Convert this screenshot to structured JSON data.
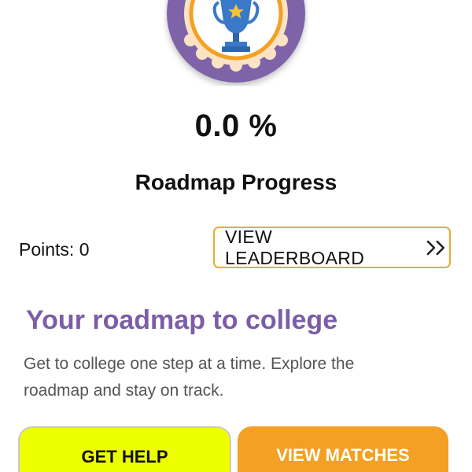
{
  "progress": {
    "value": "0.0 %",
    "label": "Roadmap Progress"
  },
  "points": {
    "text": "Points: 0"
  },
  "leaderboard": {
    "label": "VIEW LEADERBOARD",
    "icon": "double-chevron-right-icon"
  },
  "roadmap": {
    "title": "Your roadmap to college",
    "description": "Get to college one step at a time. Explore the roadmap and stay on track."
  },
  "actions": {
    "help_label": "GET HELP",
    "matches_label": "VIEW MATCHES"
  },
  "badge": {
    "icon": "trophy-icon"
  },
  "colors": {
    "accent_purple": "#7B5EA7",
    "badge_ring": "#7E64A8",
    "medal_cream": "#FBE3C4",
    "medal_orange": "#F4A023",
    "trophy_blue": "#3A78C9",
    "help_button": "#EEFF00",
    "matches_button": "#F4A023",
    "leaderboard_border": "#F0A830"
  }
}
